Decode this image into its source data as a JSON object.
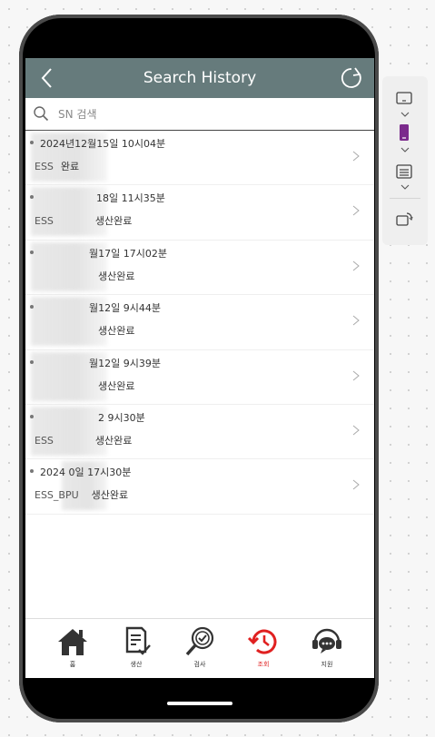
{
  "header": {
    "title": "Search History",
    "back_icon": "chevron-left-icon",
    "refresh_icon": "refresh-icon"
  },
  "search": {
    "placeholder": "SN 검색",
    "value": ""
  },
  "history": [
    {
      "date": "2024년12월15일 10시04분",
      "sn": "ESS",
      "status": "완료"
    },
    {
      "date": "18일 11시35분",
      "sn": "ESS",
      "status": "생산완료"
    },
    {
      "date": "월17일 17시02분",
      "sn": "",
      "status": "생산완료"
    },
    {
      "date": "월12일 9시44분",
      "sn": "",
      "status": "생산완료"
    },
    {
      "date": "월12일 9시39분",
      "sn": "",
      "status": "생산완료"
    },
    {
      "date": "2 9시30분",
      "sn": "ESS",
      "status": "생산완료"
    },
    {
      "date": "2024 0일 17시30분",
      "sn": "ESS_BPU",
      "status": "생산완료"
    }
  ],
  "tabs": [
    {
      "label": "홈",
      "icon": "home-icon"
    },
    {
      "label": "생산",
      "icon": "document-check-icon"
    },
    {
      "label": "검사",
      "icon": "magnifier-check-icon"
    },
    {
      "label": "조회",
      "icon": "history-icon",
      "active": true
    },
    {
      "label": "지원",
      "icon": "support-chat-icon"
    }
  ],
  "colors": {
    "header_bg": "#667b7c",
    "active_tab": "#e02020",
    "toolbar_accent": "#7b2a8c"
  }
}
